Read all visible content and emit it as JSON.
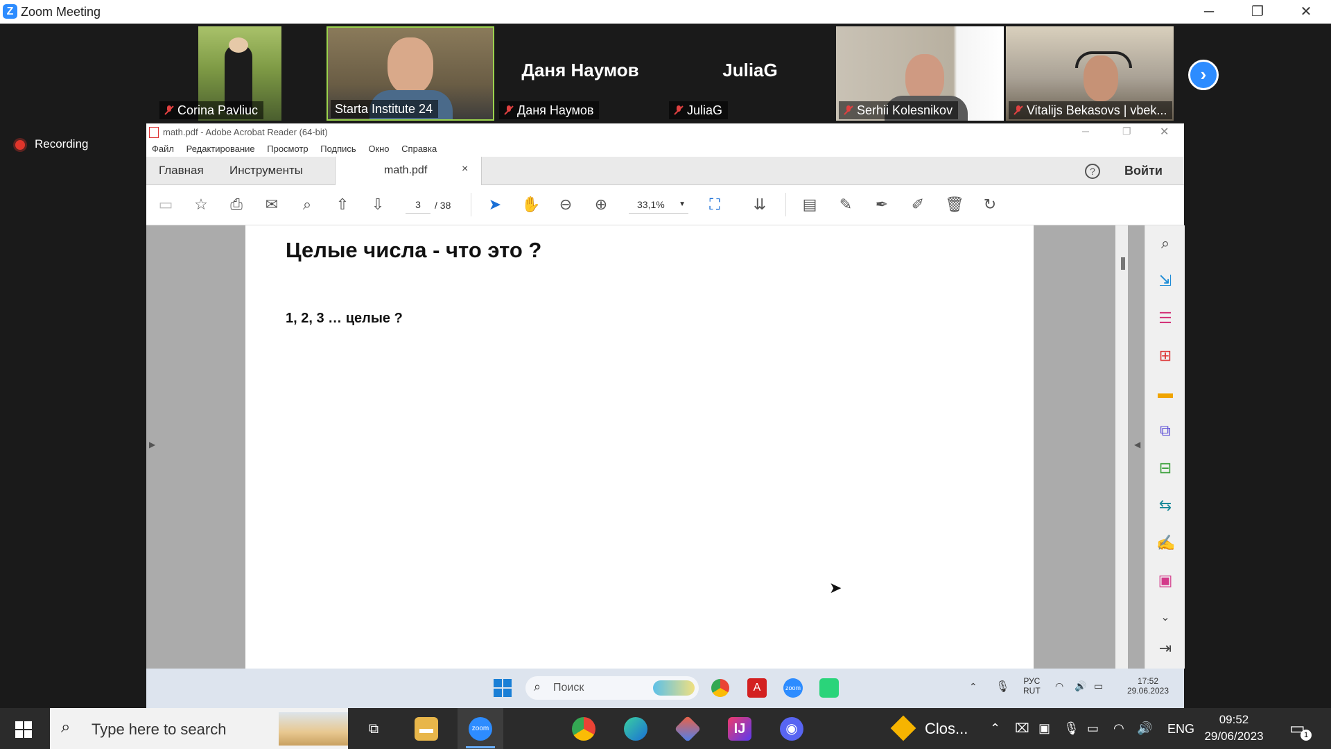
{
  "zoom": {
    "window_title": "Zoom Meeting",
    "recording_label": "Recording",
    "participants": [
      {
        "name": "Corina Pavliuc",
        "muted": true
      },
      {
        "name": "Starta Institute 24",
        "muted": false
      },
      {
        "name": "Даня Наумов",
        "muted": true,
        "display_text": "Даня Наумов"
      },
      {
        "name": "JuliaG",
        "muted": true,
        "display_text": "JuliaG"
      },
      {
        "name": "Serhii Kolesnikov",
        "muted": true
      },
      {
        "name": "Vitalijs Bekasovs | vbek...",
        "muted": true
      }
    ]
  },
  "acrobat": {
    "window_title": "math.pdf - Adobe Acrobat Reader (64-bit)",
    "menu": [
      "Файл",
      "Редактирование",
      "Просмотр",
      "Подпись",
      "Окно",
      "Справка"
    ],
    "tabs": {
      "home": "Главная",
      "tools": "Инструменты",
      "document": "math.pdf"
    },
    "login_label": "Войти",
    "help_label": "?",
    "page_current": "3",
    "page_total": "/ 38",
    "zoom_level": "33,1%",
    "page_heading": "Целые числа - что это ?",
    "page_text": "1, 2, 3 … целые ?"
  },
  "inner_taskbar": {
    "search_placeholder": "Поиск",
    "lang_top": "РУС",
    "lang_bottom": "RUT",
    "time": "17:52",
    "date": "29.06.2023"
  },
  "taskbar": {
    "search_placeholder": "Type here to search",
    "pinned_label": "Clos...",
    "lang": "ENG",
    "time": "09:52",
    "date": "29/06/2023",
    "notification_count": "1"
  }
}
